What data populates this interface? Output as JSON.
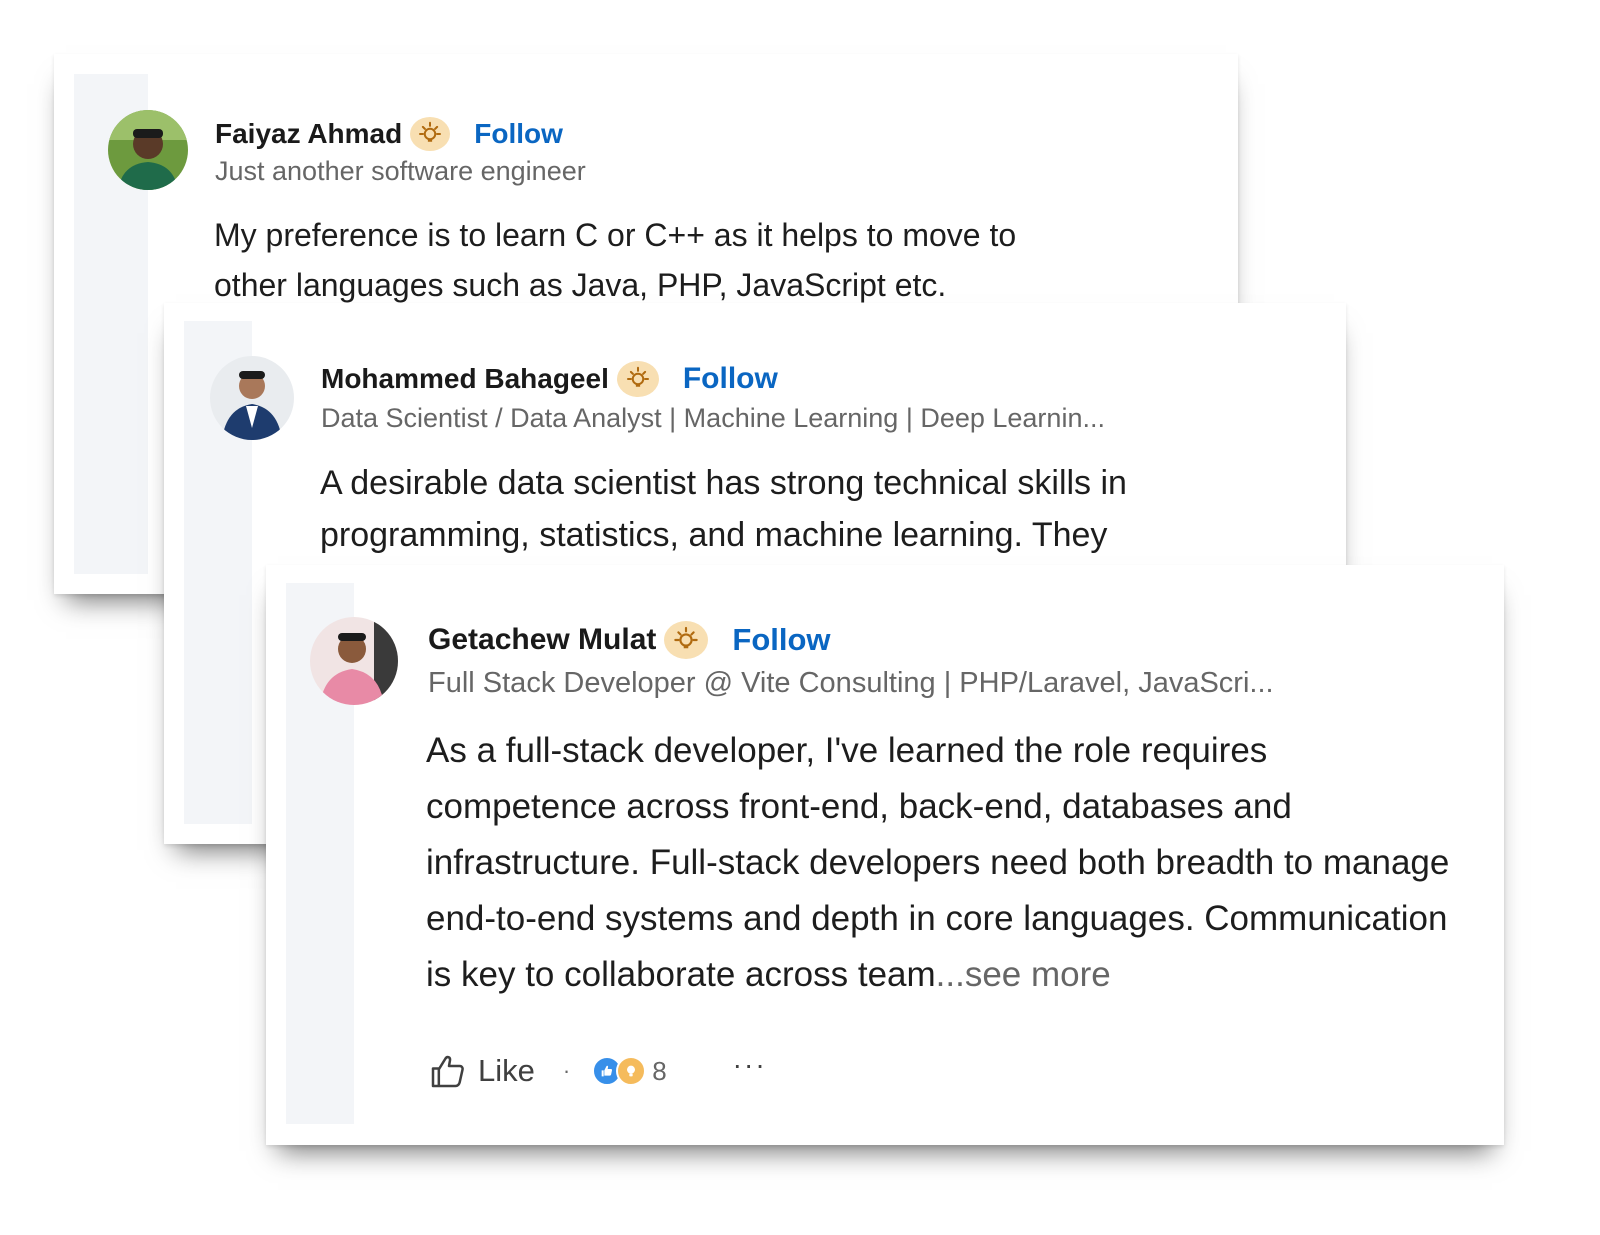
{
  "comments": [
    {
      "author": "Faiyaz Ahmad",
      "follow_label": "Follow",
      "headline": "Just another software engineer",
      "text": "My preference is to learn C or C++ as it helps to move to other languages such as Java, PHP, JavaScript etc.",
      "badge_icon": "insightful-badge-icon"
    },
    {
      "author": "Mohammed Bahageel",
      "follow_label": "Follow",
      "headline": "Data Scientist / Data Analyst | Machine Learning | Deep Learnin...",
      "text": "A desirable data scientist has strong technical skills in programming, statistics, and machine learning. They",
      "badge_icon": "insightful-badge-icon"
    },
    {
      "author": "Getachew Mulat",
      "follow_label": "Follow",
      "headline": "Full Stack Developer @ Vite Consulting | PHP/Laravel, JavaScri...",
      "text": "As a full-stack developer, I've learned the role requires competence across front-end, back-end, databases and infrastructure. Full-stack developers need both breadth to manage end-to-end systems and depth in core languages. Communication is key to collaborate across team",
      "see_more": "...see more",
      "badge_icon": "insightful-badge-icon",
      "actions": {
        "like_label": "Like",
        "separator": "·",
        "reaction_icons": [
          "like-reaction-icon",
          "insightful-reaction-icon"
        ],
        "reaction_count": "8",
        "more_label": "···"
      }
    }
  ],
  "colors": {
    "follow": "#0a66c2",
    "badge_bg": "#f8dfb2",
    "rail": "#f3f5f8",
    "secondary_text": "#666666",
    "like_reaction": "#378fe9",
    "insightful_reaction": "#f5bb5c"
  }
}
